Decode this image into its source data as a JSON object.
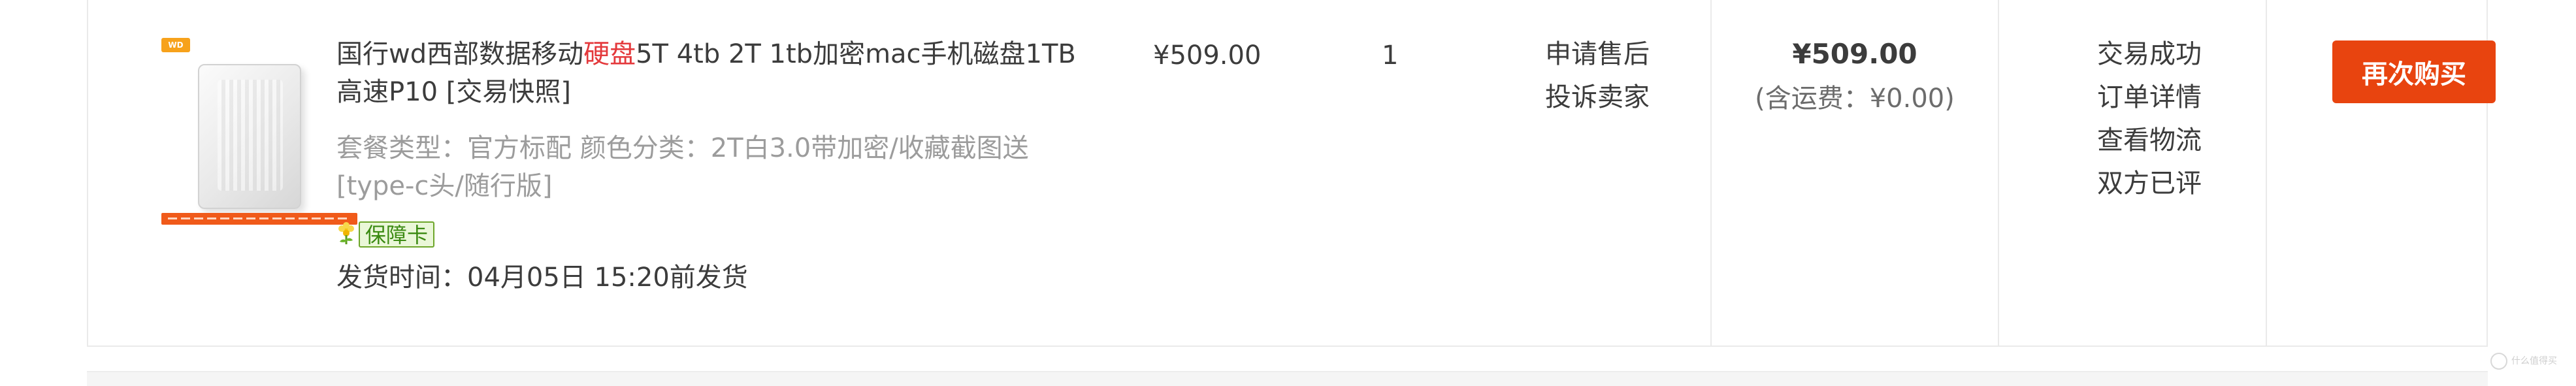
{
  "order_item": {
    "thumb_badge": "WD",
    "title_before": "国行wd西部数据移动",
    "title_highlight": "硬盘",
    "title_after": "5T 4tb 2T 1tb加密mac手机磁盘1TB高速P10 [交易快照]",
    "specs": "套餐类型：官方标配  颜色分类：2T白3.0带加密/收藏截图送[type-c头/随行版]",
    "guarantee_label": "保障卡",
    "ship_time": "发货时间：04月05日 15:20前发货",
    "unit_price": "¥509.00",
    "quantity": "1",
    "aftersale": {
      "request_service": "申请售后",
      "complain_seller": "投诉卖家"
    },
    "total": {
      "amount": "¥509.00",
      "shipping": "(含运费：¥0.00)"
    },
    "status": {
      "trade_state": "交易成功",
      "order_detail": "订单详情",
      "view_logistics": "查看物流",
      "review_state": "双方已评"
    },
    "action": {
      "rebuy_label": "再次购买"
    }
  },
  "watermark": {
    "text": "什么值得买"
  },
  "colors": {
    "accent_orange": "#e8440f",
    "title_highlight_red": "#e4393c",
    "guarantee_green": "#3b8a12"
  },
  "icons": {
    "guarantee": "flower-badge-icon",
    "watermark": "logo-circle-icon"
  }
}
